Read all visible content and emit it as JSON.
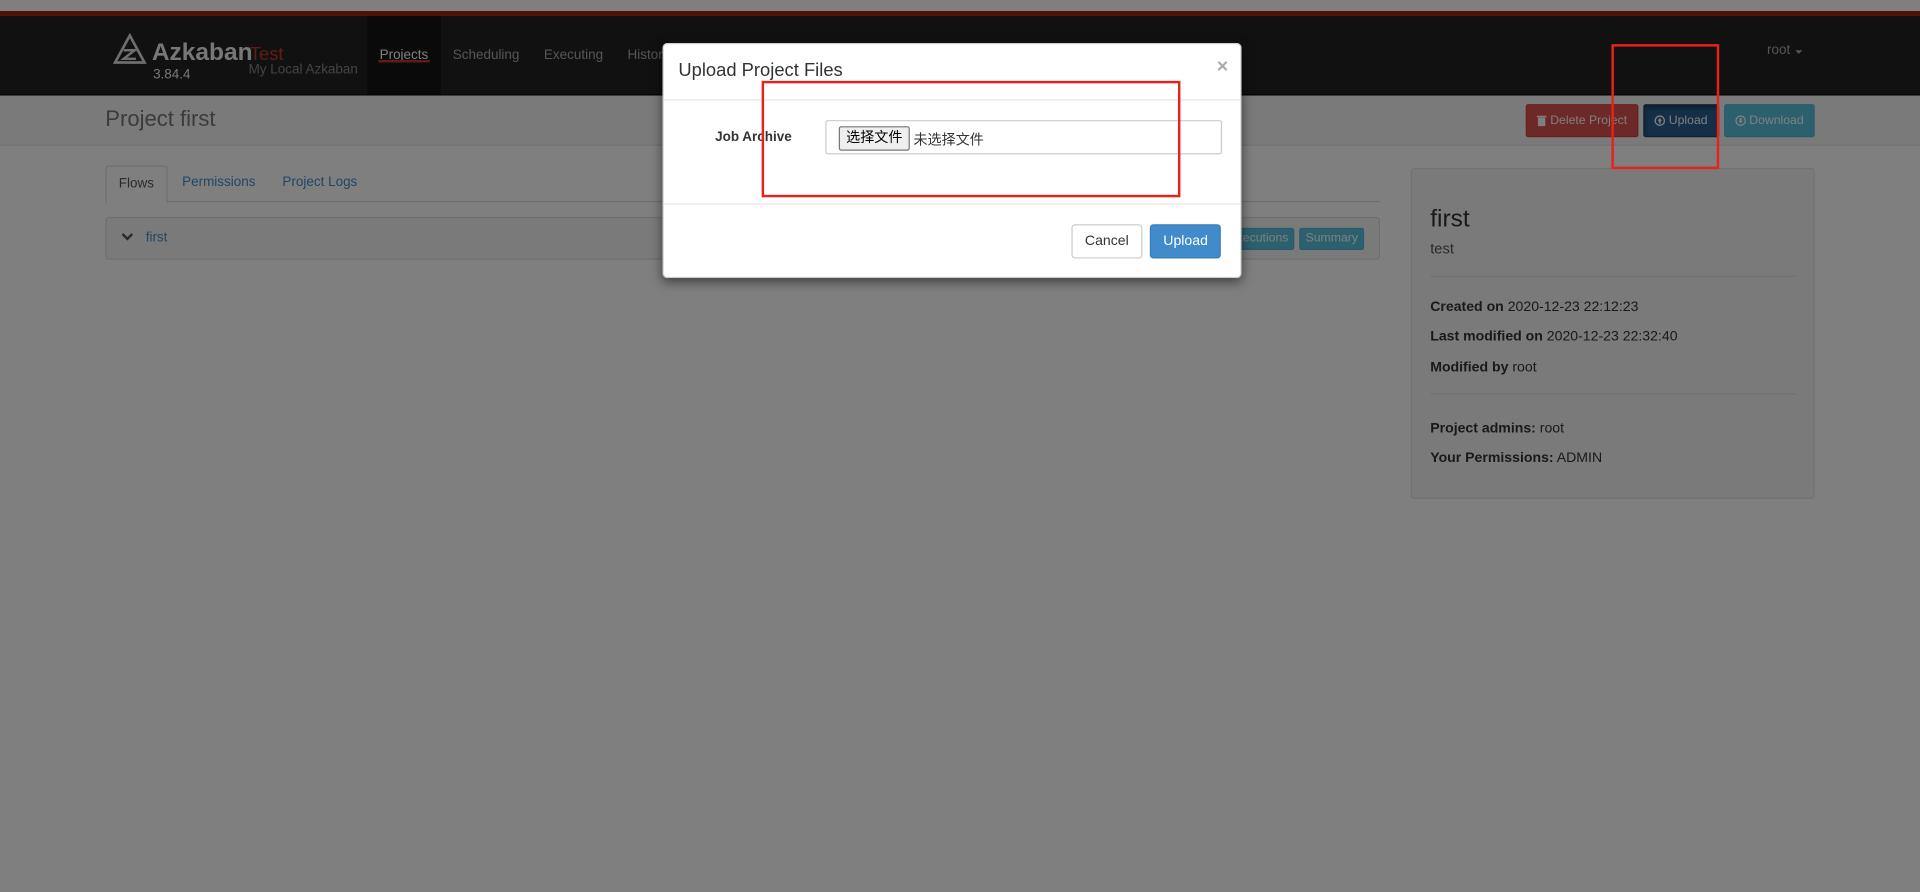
{
  "brand": {
    "name": "Azkaban",
    "environment": "Test",
    "version": "3.84.4",
    "subtitle": "My Local Azkaban"
  },
  "nav": {
    "items": [
      {
        "label": "Projects",
        "active": true
      },
      {
        "label": "Scheduling",
        "active": false
      },
      {
        "label": "Executing",
        "active": false
      },
      {
        "label": "History",
        "active": false
      }
    ],
    "user": "root"
  },
  "header": {
    "project_title": "Project first",
    "delete_label": "Delete Project",
    "upload_label": "Upload",
    "download_label": "Download"
  },
  "tabs": [
    {
      "label": "Flows",
      "active": true
    },
    {
      "label": "Permissions",
      "active": false
    },
    {
      "label": "Project Logs",
      "active": false
    }
  ],
  "flow": {
    "name": "first",
    "executions_label": "Executions",
    "summary_label": "Summary"
  },
  "project_info": {
    "name": "first",
    "description": "test",
    "created_label": "Created on",
    "created_value": "2020-12-23 22:12:23",
    "modified_label": "Last modified on",
    "modified_value": "2020-12-23 22:32:40",
    "modified_by_label": "Modified by",
    "modified_by_value": "root",
    "admins_label": "Project admins:",
    "admins_value": "root",
    "permissions_label": "Your Permissions:",
    "permissions_value": "ADMIN"
  },
  "modal": {
    "title": "Upload Project Files",
    "close": "×",
    "field_label": "Job Archive",
    "file_button": "选择文件",
    "file_status": "未选择文件",
    "cancel_label": "Cancel",
    "upload_label": "Upload"
  },
  "colors": {
    "navbar": "#222222",
    "accent": "#c0392b",
    "primary": "#428bca",
    "danger": "#d9534f",
    "info": "#5bc0de",
    "annotation": "#e8211a"
  }
}
